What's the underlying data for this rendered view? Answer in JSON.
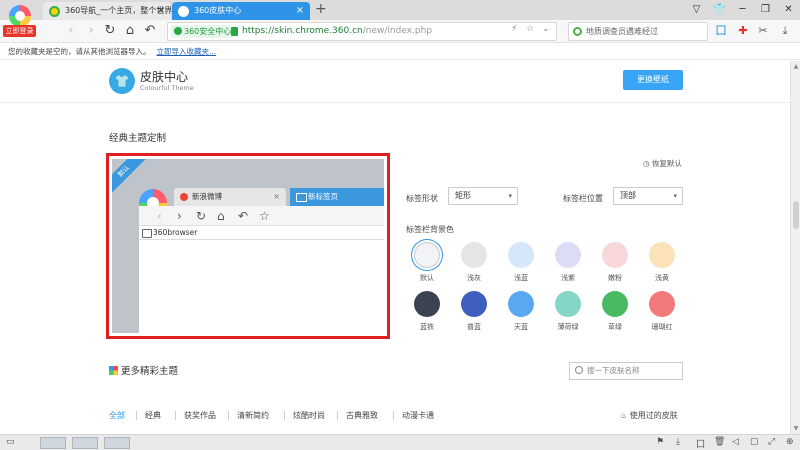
{
  "login_badge": "立即登录",
  "tabs": [
    {
      "label": "360导航_一个主页，整个世界",
      "close": "×"
    },
    {
      "label": "360皮肤中心",
      "close": "×"
    }
  ],
  "new_tab": "+",
  "window_controls": [
    "▽",
    "👕",
    "─",
    "❐",
    "✕"
  ],
  "nav": {
    "back": "‹",
    "forward": "›",
    "refresh": "↻",
    "home": "⌂",
    "undo": "↶",
    "star": "☆"
  },
  "address": {
    "security_badge": "360安全中心",
    "url_main": "https://skin.chrome.360.cn",
    "url_path": "/new/index.php"
  },
  "search": {
    "placeholder": "地质调查员遇难经过"
  },
  "bookmark_bar": {
    "text": "您的收藏夹是空的，请从其他浏览器导入。",
    "link": "立即导入收藏夹..."
  },
  "skin_center": {
    "title": "皮肤中心",
    "subtitle": "Colourful Theme",
    "change_wallpaper": "更换壁纸",
    "logo_glyph": "👕"
  },
  "classic": {
    "title": "经典主题定制",
    "restore": "恢复默认",
    "ribbon": "默认",
    "preview_tab1": "新浪微博",
    "preview_tab2": "新标签页",
    "preview_bookmark": "360browser"
  },
  "tab_shape": {
    "label": "标签形状",
    "value": "矩形"
  },
  "tab_position": {
    "label": "标签栏位置",
    "value": "顶部"
  },
  "bg_label": "标签栏背景色",
  "swatches": [
    {
      "name": "默认",
      "color": "#f1f3f6"
    },
    {
      "name": "浅灰",
      "color": "#e4e5e7"
    },
    {
      "name": "浅蓝",
      "color": "#d6e7fb"
    },
    {
      "name": "浅紫",
      "color": "#dcdcf6"
    },
    {
      "name": "嫩粉",
      "color": "#f7d7da"
    },
    {
      "name": "浅黄",
      "color": "#fbe2b8"
    },
    {
      "name": "蓝铁",
      "color": "#3b4250"
    },
    {
      "name": "普蓝",
      "color": "#3f5fbf"
    },
    {
      "name": "天蓝",
      "color": "#59a8f0"
    },
    {
      "name": "薄荷绿",
      "color": "#84d6c6"
    },
    {
      "name": "草绿",
      "color": "#48b861"
    },
    {
      "name": "珊瑚红",
      "color": "#f27a7a"
    }
  ],
  "more": {
    "title": "更多精彩主题",
    "search_placeholder": "搜一下皮肤名称"
  },
  "categories": [
    "全部",
    "经典",
    "获奖作品",
    "清新简约",
    "炫酷时尚",
    "古典雅致",
    "动漫卡通"
  ],
  "used_skins": "使用过的皮肤"
}
